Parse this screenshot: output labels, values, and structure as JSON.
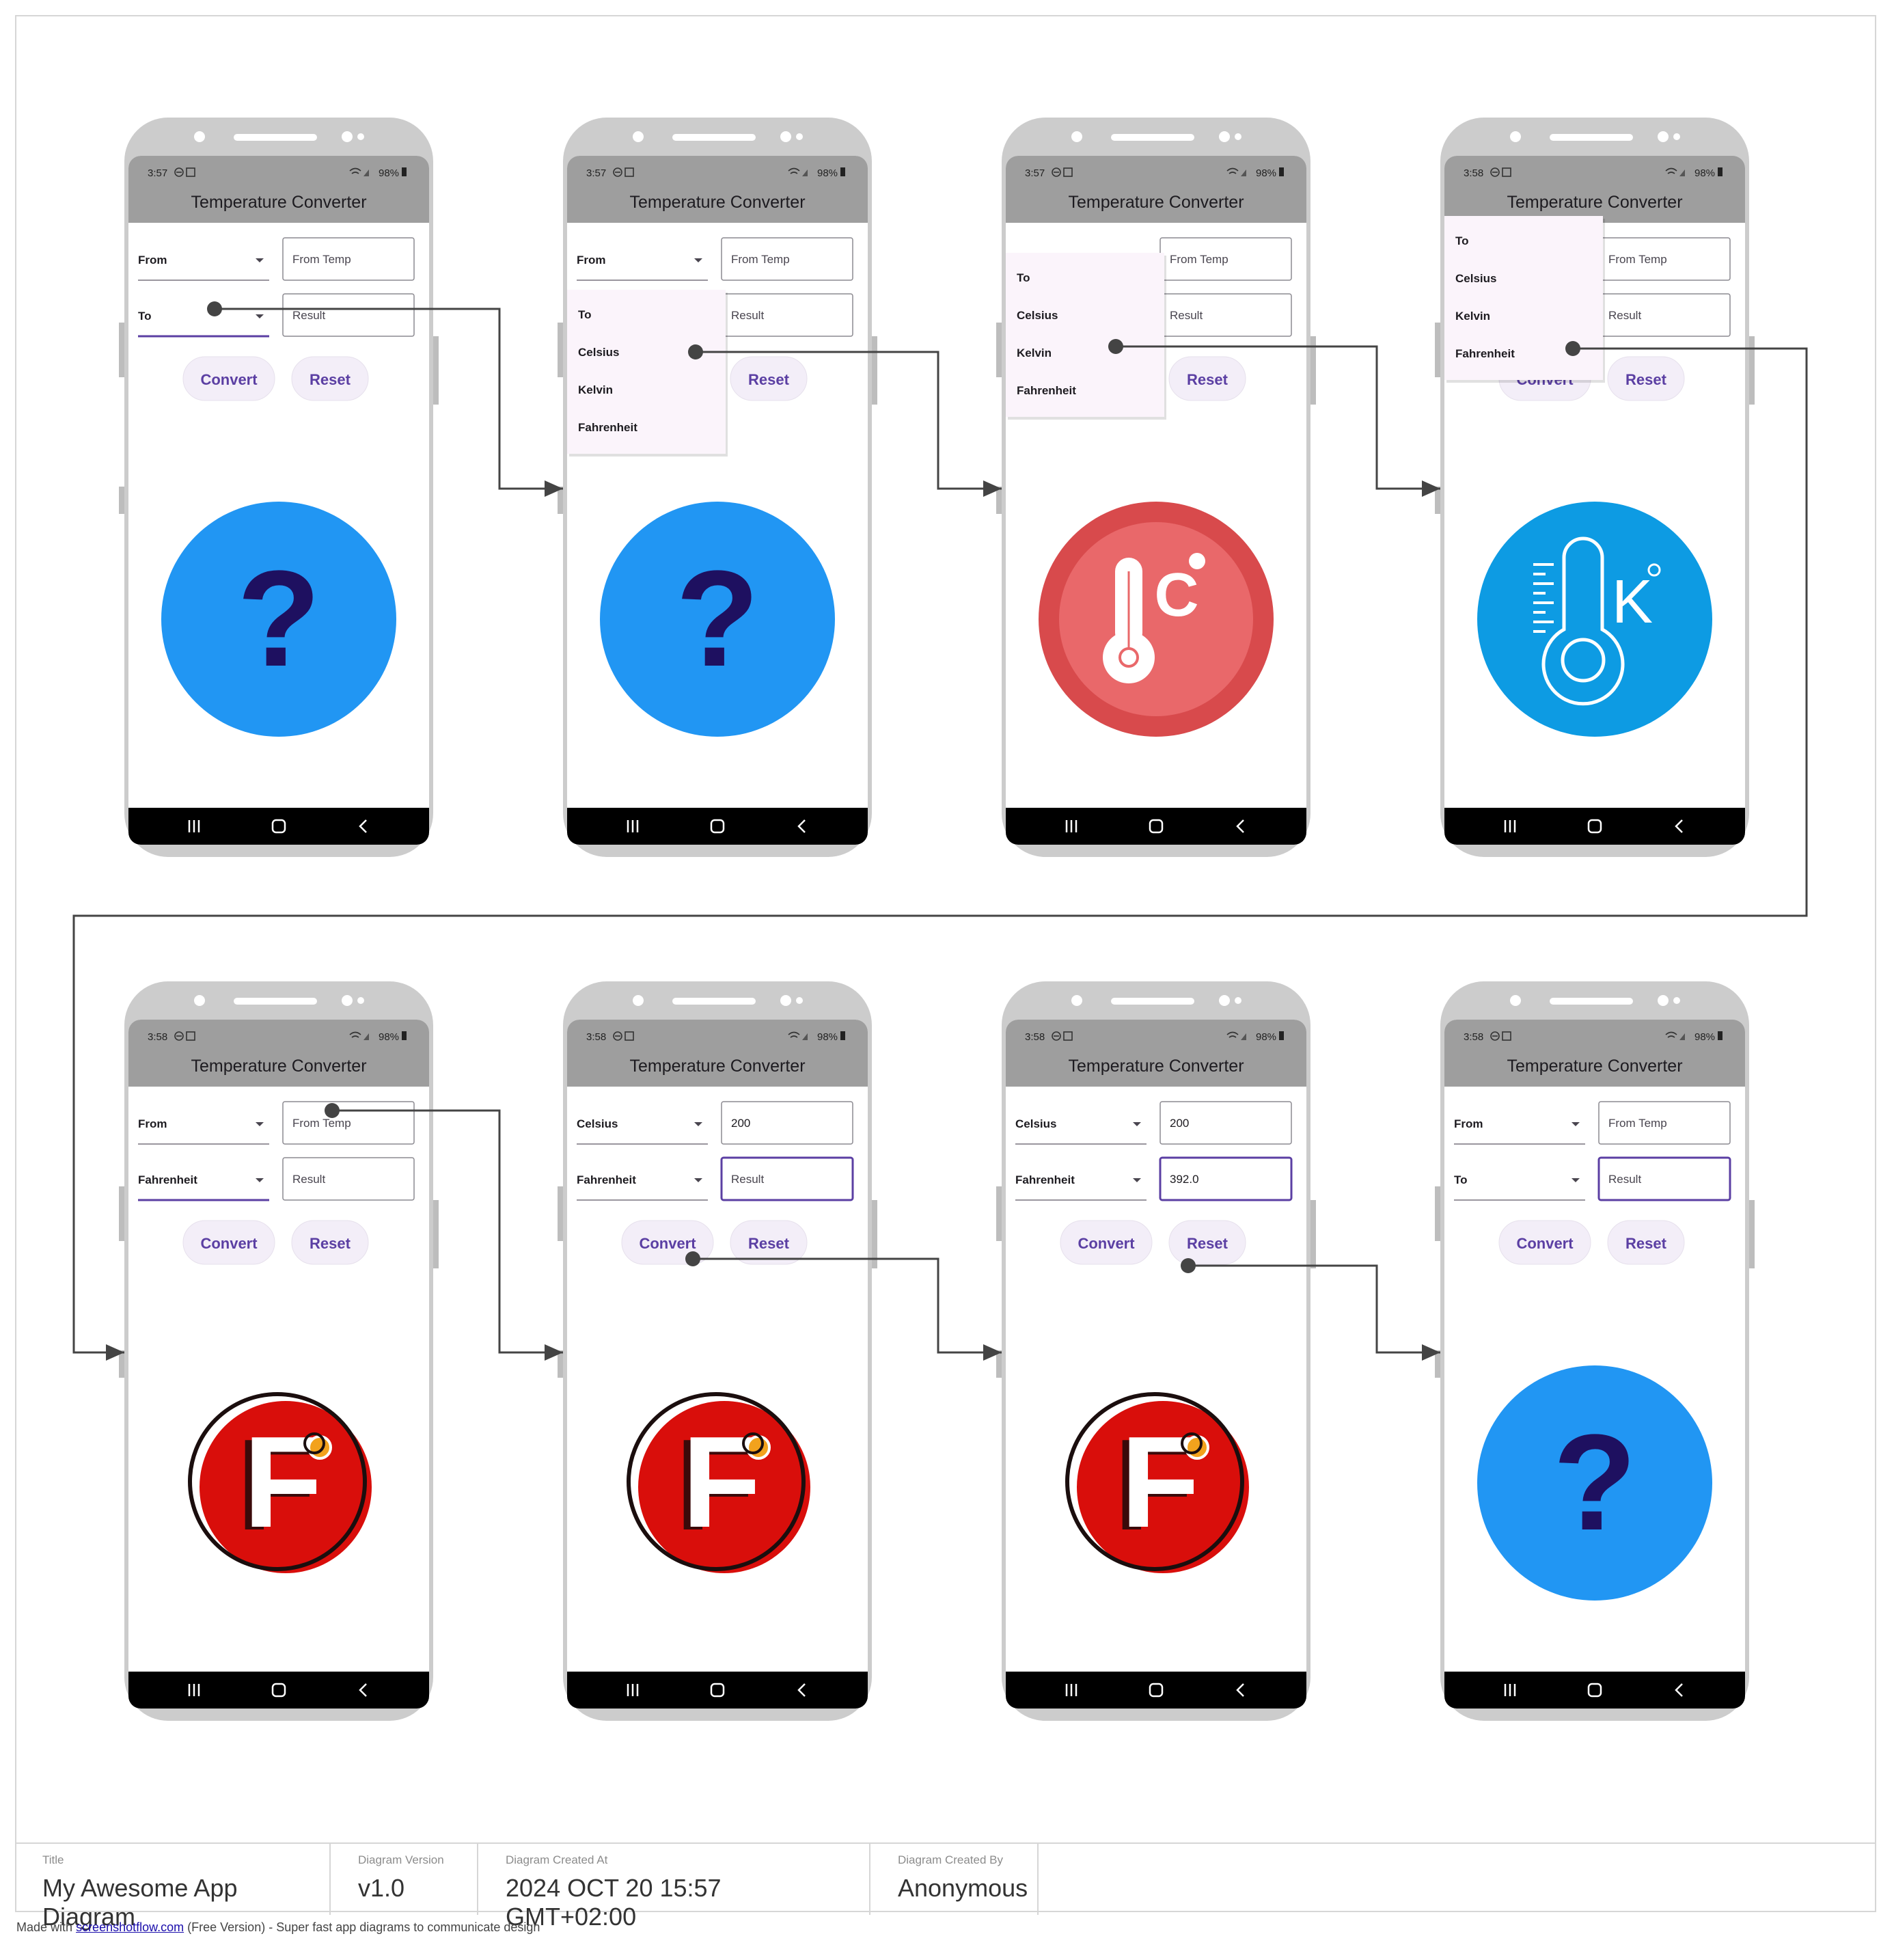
{
  "app": {
    "title": "Temperature Converter",
    "labels": {
      "from": "From",
      "to": "To",
      "from_temp": "From Temp",
      "result": "Result"
    },
    "buttons": {
      "convert": "Convert",
      "reset": "Reset"
    },
    "status": {
      "battery": "98%"
    },
    "menu_items": [
      "To",
      "Celsius",
      "Kelvin",
      "Fahrenheit"
    ],
    "question_mark": "?",
    "letters": {
      "c": "C",
      "k": "K",
      "f": "F"
    }
  },
  "screens": [
    {
      "time": "3:57",
      "from": "From",
      "to": "To",
      "from_temp": "From Temp",
      "result": "Result",
      "icon": "question-icon"
    },
    {
      "time": "3:57",
      "from": "From",
      "to": "",
      "from_temp": "From Temp",
      "result": "Result",
      "icon": "question-icon"
    },
    {
      "time": "3:57",
      "from": "",
      "to": "",
      "from_temp": "From Temp",
      "result": "Result",
      "icon": "celsius-thermometer-icon"
    },
    {
      "time": "3:58",
      "from": "",
      "to": "",
      "from_temp": "From Temp",
      "result": "Result",
      "icon": "kelvin-thermometer-icon"
    },
    {
      "time": "3:58",
      "from": "From",
      "to": "Fahrenheit",
      "from_temp": "From Temp",
      "result": "Result",
      "icon": "fahrenheit-icon"
    },
    {
      "time": "3:58",
      "from": "Celsius",
      "to": "Fahrenheit",
      "from_temp": "200",
      "result": "Result",
      "icon": "fahrenheit-icon"
    },
    {
      "time": "3:58",
      "from": "Celsius",
      "to": "Fahrenheit",
      "from_temp": "200",
      "result": "392.0",
      "icon": "fahrenheit-icon"
    },
    {
      "time": "3:58",
      "from": "From",
      "to": "To",
      "from_temp": "From Temp",
      "result": "Result",
      "icon": "question-icon"
    }
  ],
  "footer": {
    "title_label": "Title",
    "title": "My Awesome App Diagram",
    "version_label": "Diagram Version",
    "version": "v1.0",
    "created_at_label": "Diagram Created At",
    "created_at": "2024 OCT 20 15:57 GMT+02:00",
    "created_by_label": "Diagram Created By",
    "created_by": "Anonymous"
  },
  "credit": {
    "prefix": "Made with",
    "link": "screenshotflow.com",
    "suffix": "(Free Version) - Super fast app diagrams to communicate design"
  },
  "colors": {
    "phone_frame": "#cccccc",
    "app_bar": "#9e9e9e",
    "accent": "#5b3fa3",
    "button_bg": "#f3eef8",
    "menu_bg": "#fbf4fb",
    "question_blue": "#2196f3",
    "question_mark": "#1e1060",
    "celsius_red": "#e9686a",
    "kelvin_blue": "#0d9be3",
    "fahrenheit_red": "#d90e0b",
    "connector": "#444444"
  }
}
